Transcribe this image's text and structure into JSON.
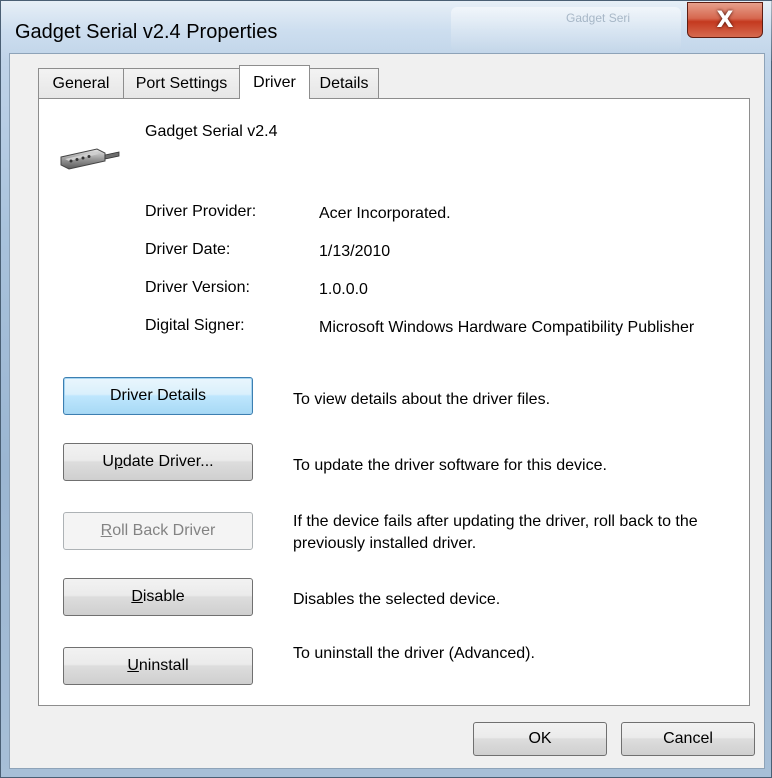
{
  "window": {
    "title": "Gadget Serial v2.4 Properties",
    "background_window_text": "Gadget Seri",
    "close_symbol": "X"
  },
  "tabs": [
    {
      "label": "General",
      "active": false
    },
    {
      "label": "Port Settings",
      "active": false
    },
    {
      "label": "Driver",
      "active": true
    },
    {
      "label": "Details",
      "active": false
    }
  ],
  "device": {
    "name": "Gadget Serial v2.4",
    "icon": "serial-port-connector-icon"
  },
  "driver_info": [
    {
      "label": "Driver Provider:",
      "value": "Acer Incorporated."
    },
    {
      "label": "Driver Date:",
      "value": "1/13/2010"
    },
    {
      "label": "Driver Version:",
      "value": "1.0.0.0"
    },
    {
      "label": "Digital Signer:",
      "value": "Microsoft Windows Hardware Compatibility Publisher"
    }
  ],
  "actions": [
    {
      "label_pre": "Driver Details",
      "mnemonic": "",
      "label_post": "",
      "description": "To view details about the driver files.",
      "state": "focused"
    },
    {
      "label_pre": "U",
      "mnemonic": "p",
      "label_post": "date Driver...",
      "description": "To update the driver software for this device.",
      "state": "normal"
    },
    {
      "label_pre": "",
      "mnemonic": "R",
      "label_post": "oll Back Driver",
      "description": "If the device fails after updating the driver, roll back to the previously installed driver.",
      "state": "disabled"
    },
    {
      "label_pre": "",
      "mnemonic": "D",
      "label_post": "isable",
      "description": "Disables the selected device.",
      "state": "normal"
    },
    {
      "label_pre": "",
      "mnemonic": "U",
      "label_post": "ninstall",
      "description": "To uninstall the driver (Advanced).",
      "state": "normal"
    }
  ],
  "footer": {
    "ok_label": "OK",
    "cancel_label": "Cancel"
  },
  "colors": {
    "focus_border": "#3c7fb1",
    "close_red": "#c4391f",
    "disabled_text": "#838383"
  }
}
